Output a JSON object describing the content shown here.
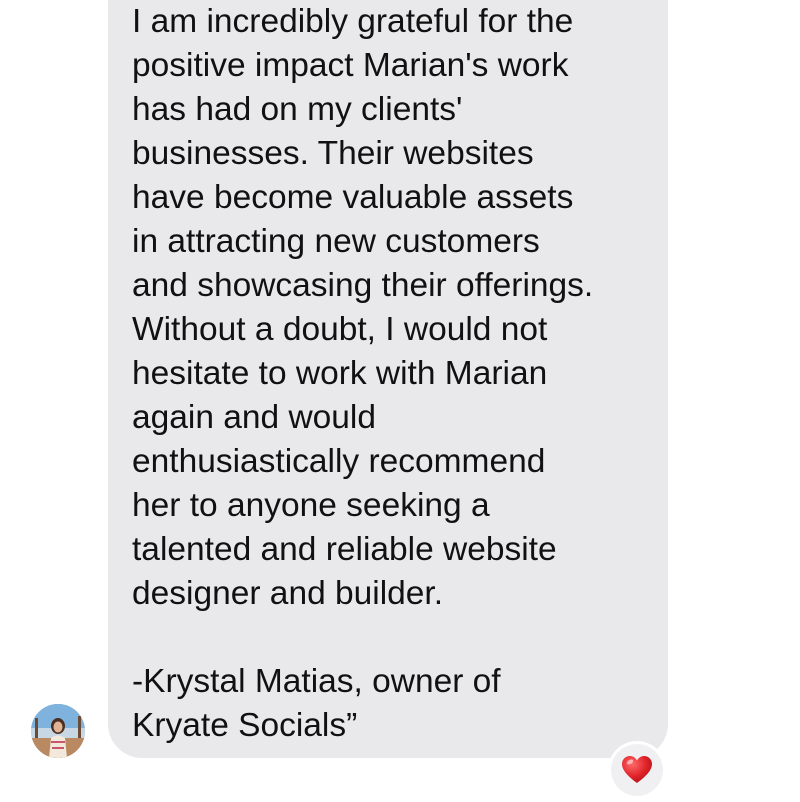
{
  "message": {
    "lines": [
      "I am incredibly grateful for the",
      "positive impact Marian's work",
      "has had on my clients'",
      "businesses. Their websites",
      "have become valuable assets",
      "in attracting new customers",
      "and showcasing their offerings.",
      "Without a doubt, I would not",
      "hesitate to work with Marian",
      "again and would",
      "enthusiastically recommend",
      "her to anyone seeking a",
      "talented and reliable website",
      "designer and builder.",
      "",
      "-Krystal Matias, owner of",
      "Kryate Socials”"
    ]
  },
  "sender": {
    "avatar_icon": "profile-photo"
  },
  "reaction": {
    "icon": "red-heart-icon",
    "color": "#e0242a"
  },
  "colors": {
    "bubble": "#e9e9eb",
    "text": "#111111",
    "background": "#ffffff"
  }
}
